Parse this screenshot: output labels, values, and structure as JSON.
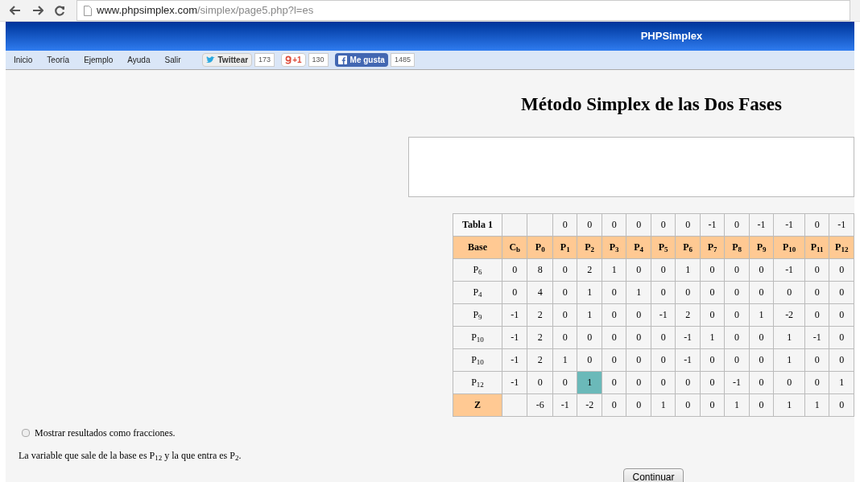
{
  "browser": {
    "url_domain": "www.phpsimplex.com",
    "url_path": "/simplex/page5.php?l=es"
  },
  "header": {
    "title": "PHPSimplex"
  },
  "nav": {
    "items": [
      "Inicio",
      "Teoría",
      "Ejemplo",
      "Ayuda",
      "Salir"
    ]
  },
  "social": [
    {
      "kind": "twitter",
      "label": "Twittear",
      "count": "173"
    },
    {
      "kind": "gplus",
      "label": "+1",
      "count": "130"
    },
    {
      "kind": "facebook",
      "label": "Me gusta",
      "count": "1485"
    }
  ],
  "page_title": "Método Simplex de las Dos Fases",
  "table": {
    "cost_row": {
      "label": "Tabla 1",
      "costs": [
        "0",
        "0",
        "0",
        "0",
        "0",
        "0",
        "-1",
        "0",
        "-1",
        "-1",
        "0",
        "-1"
      ]
    },
    "base_header": "Base",
    "columns": [
      "C$_{b}$",
      "P$_{0}$",
      "P$_{1}$",
      "P$_{2}$",
      "P$_{3}$",
      "P$_{4}$",
      "P$_{5}$",
      "P$_{6}$",
      "P$_{7}$",
      "P$_{8}$",
      "P$_{9}$",
      "P$_{10}$",
      "P$_{11}$",
      "P$_{12}$"
    ],
    "rows": [
      {
        "base": "P$_{6}$",
        "cells": [
          {
            "v": "0",
            "selected": false
          },
          {
            "v": "8",
            "selected": false
          },
          {
            "v": "0",
            "selected": false
          },
          {
            "v": "2",
            "selected": false
          },
          {
            "v": "1",
            "selected": false
          },
          {
            "v": "0",
            "selected": false
          },
          {
            "v": "0",
            "selected": false
          },
          {
            "v": "1",
            "selected": false
          },
          {
            "v": "0",
            "selected": false
          },
          {
            "v": "0",
            "selected": false
          },
          {
            "v": "0",
            "selected": false
          },
          {
            "v": "-1",
            "selected": false
          },
          {
            "v": "0",
            "selected": false
          },
          {
            "v": "0",
            "selected": false
          }
        ]
      },
      {
        "base": "P$_{4}$",
        "cells": [
          {
            "v": "0",
            "selected": false
          },
          {
            "v": "4",
            "selected": false
          },
          {
            "v": "0",
            "selected": false
          },
          {
            "v": "1",
            "selected": false
          },
          {
            "v": "0",
            "selected": false
          },
          {
            "v": "1",
            "selected": false
          },
          {
            "v": "0",
            "selected": false
          },
          {
            "v": "0",
            "selected": false
          },
          {
            "v": "0",
            "selected": false
          },
          {
            "v": "0",
            "selected": false
          },
          {
            "v": "0",
            "selected": false
          },
          {
            "v": "0",
            "selected": false
          },
          {
            "v": "0",
            "selected": false
          },
          {
            "v": "0",
            "selected": false
          }
        ]
      },
      {
        "base": "P$_{9}$",
        "cells": [
          {
            "v": "-1",
            "selected": false
          },
          {
            "v": "2",
            "selected": false
          },
          {
            "v": "0",
            "selected": false
          },
          {
            "v": "1",
            "selected": false
          },
          {
            "v": "0",
            "selected": false
          },
          {
            "v": "0",
            "selected": false
          },
          {
            "v": "-1",
            "selected": false
          },
          {
            "v": "2",
            "selected": false
          },
          {
            "v": "0",
            "selected": false
          },
          {
            "v": "0",
            "selected": false
          },
          {
            "v": "1",
            "selected": false
          },
          {
            "v": "-2",
            "selected": false
          },
          {
            "v": "0",
            "selected": false
          },
          {
            "v": "0",
            "selected": false
          }
        ]
      },
      {
        "base": "P$_{10}$",
        "cells": [
          {
            "v": "-1",
            "selected": false
          },
          {
            "v": "2",
            "selected": false
          },
          {
            "v": "0",
            "selected": false
          },
          {
            "v": "0",
            "selected": false
          },
          {
            "v": "0",
            "selected": false
          },
          {
            "v": "0",
            "selected": false
          },
          {
            "v": "0",
            "selected": false
          },
          {
            "v": "-1",
            "selected": false
          },
          {
            "v": "1",
            "selected": false
          },
          {
            "v": "0",
            "selected": false
          },
          {
            "v": "0",
            "selected": false
          },
          {
            "v": "1",
            "selected": false
          },
          {
            "v": "-1",
            "selected": false
          },
          {
            "v": "0",
            "selected": false
          }
        ]
      },
      {
        "base": "P$_{10}$",
        "cells": [
          {
            "v": "-1",
            "selected": false
          },
          {
            "v": "2",
            "selected": false
          },
          {
            "v": "1",
            "selected": false
          },
          {
            "v": "0",
            "selected": false
          },
          {
            "v": "0",
            "selected": false
          },
          {
            "v": "0",
            "selected": false
          },
          {
            "v": "0",
            "selected": false
          },
          {
            "v": "-1",
            "selected": false
          },
          {
            "v": "0",
            "selected": false
          },
          {
            "v": "0",
            "selected": false
          },
          {
            "v": "0",
            "selected": false
          },
          {
            "v": "1",
            "selected": false
          },
          {
            "v": "0",
            "selected": false
          },
          {
            "v": "0",
            "selected": false
          }
        ]
      },
      {
        "base": "P$_{12}$",
        "cells": [
          {
            "v": "-1",
            "selected": false
          },
          {
            "v": "0",
            "selected": false
          },
          {
            "v": "0",
            "selected": false
          },
          {
            "v": "1",
            "selected": true
          },
          {
            "v": "0",
            "selected": false
          },
          {
            "v": "0",
            "selected": false
          },
          {
            "v": "0",
            "selected": false
          },
          {
            "v": "0",
            "selected": false
          },
          {
            "v": "0",
            "selected": false
          },
          {
            "v": "-1",
            "selected": false
          },
          {
            "v": "0",
            "selected": false
          },
          {
            "v": "0",
            "selected": false
          },
          {
            "v": "0",
            "selected": false
          },
          {
            "v": "1",
            "selected": false
          }
        ]
      }
    ],
    "z_row": {
      "label": "Z",
      "values": [
        "-6",
        "-1",
        "-2",
        "0",
        "0",
        "1",
        "0",
        "0",
        "1",
        "0",
        "1",
        "1",
        "0"
      ]
    }
  },
  "fractions_checkbox": {
    "label": "Mostrar resultados como fracciones.",
    "checked": false
  },
  "message": "La variable que sale de la base es P$_{12}$ y la que entra es P$_{2}$.",
  "continue_button": "Continuar"
}
